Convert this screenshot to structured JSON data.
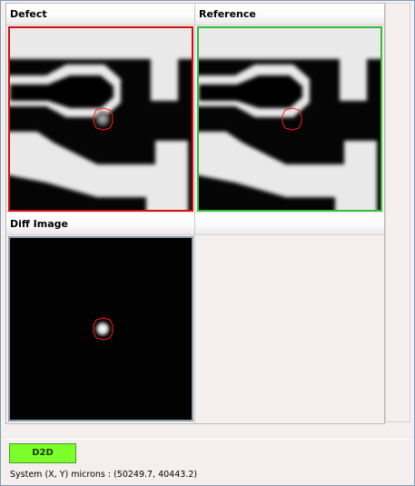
{
  "panels": [
    {
      "title": "Defect"
    },
    {
      "title": "Reference"
    },
    {
      "title": "Diff Image"
    },
    {
      "title": ""
    }
  ],
  "colors": {
    "defect_border": "#d01010",
    "reference_border": "#2fbf3a",
    "diff_border": "#8a9db0",
    "mode_button": "#7dff2a",
    "defect_outline": "#ff2020"
  },
  "mode_button": {
    "label": "D2D"
  },
  "status": {
    "coords_label": "System (X, Y) microns : (50249.7, 40443.2)"
  }
}
